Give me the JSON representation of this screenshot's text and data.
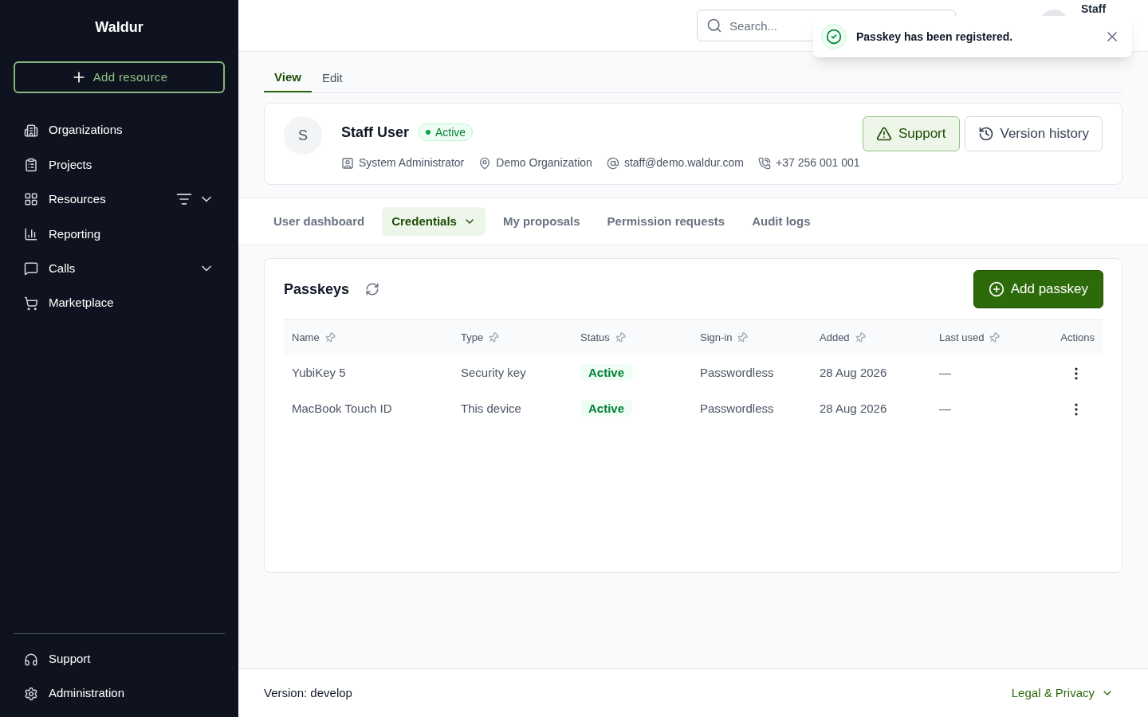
{
  "sidebar": {
    "brand": "Waldur",
    "add_button": "Add resource",
    "items": [
      {
        "label": "Organizations"
      },
      {
        "label": "Projects"
      },
      {
        "label": "Resources",
        "expanded": false,
        "filter": true
      },
      {
        "label": "Reporting"
      },
      {
        "label": "Calls",
        "expanded": false
      },
      {
        "label": "Marketplace"
      }
    ],
    "bottom_items": [
      {
        "label": "Support"
      },
      {
        "label": "Administration"
      }
    ]
  },
  "header": {
    "search": {
      "placeholder": "Search..."
    },
    "user": "Staff"
  },
  "toast": {
    "message": "Passkey has been registered."
  },
  "page_tabs": [
    {
      "label": "View",
      "selected": true
    },
    {
      "label": "Edit",
      "selected": false
    }
  ],
  "profile": {
    "initial": "S",
    "name": "Staff User",
    "status": "Active",
    "role": "System Administrator",
    "organization": "Demo Organization",
    "email": "staff@demo.waldur.com",
    "phone": "+37 256 001 001",
    "buttons": [
      "Support",
      "Version history"
    ]
  },
  "section_tabs": [
    {
      "label": "User dashboard",
      "selected": false
    },
    {
      "label": "Credentials",
      "selected": true,
      "dropdown": true
    },
    {
      "label": "My proposals",
      "selected": false
    },
    {
      "label": "Permission requests",
      "selected": false
    },
    {
      "label": "Audit logs",
      "selected": false
    }
  ],
  "passkeys": {
    "title": "Passkeys",
    "add_button": "Add passkey",
    "columns": [
      "Name",
      "Type",
      "Status",
      "Sign-in",
      "Added",
      "Last used",
      "Actions"
    ],
    "rows": [
      {
        "name": "YubiKey 5",
        "type": "Security key",
        "status": "Active",
        "sign_in": "Passwordless",
        "added": "28 Aug 2026",
        "last_used": "—"
      },
      {
        "name": "MacBook Touch ID",
        "type": "This device",
        "status": "Active",
        "sign_in": "Passwordless",
        "added": "28 Aug 2026",
        "last_used": "—"
      }
    ]
  },
  "footer": {
    "version": "Version: develop",
    "legal": "Legal & Privacy"
  }
}
